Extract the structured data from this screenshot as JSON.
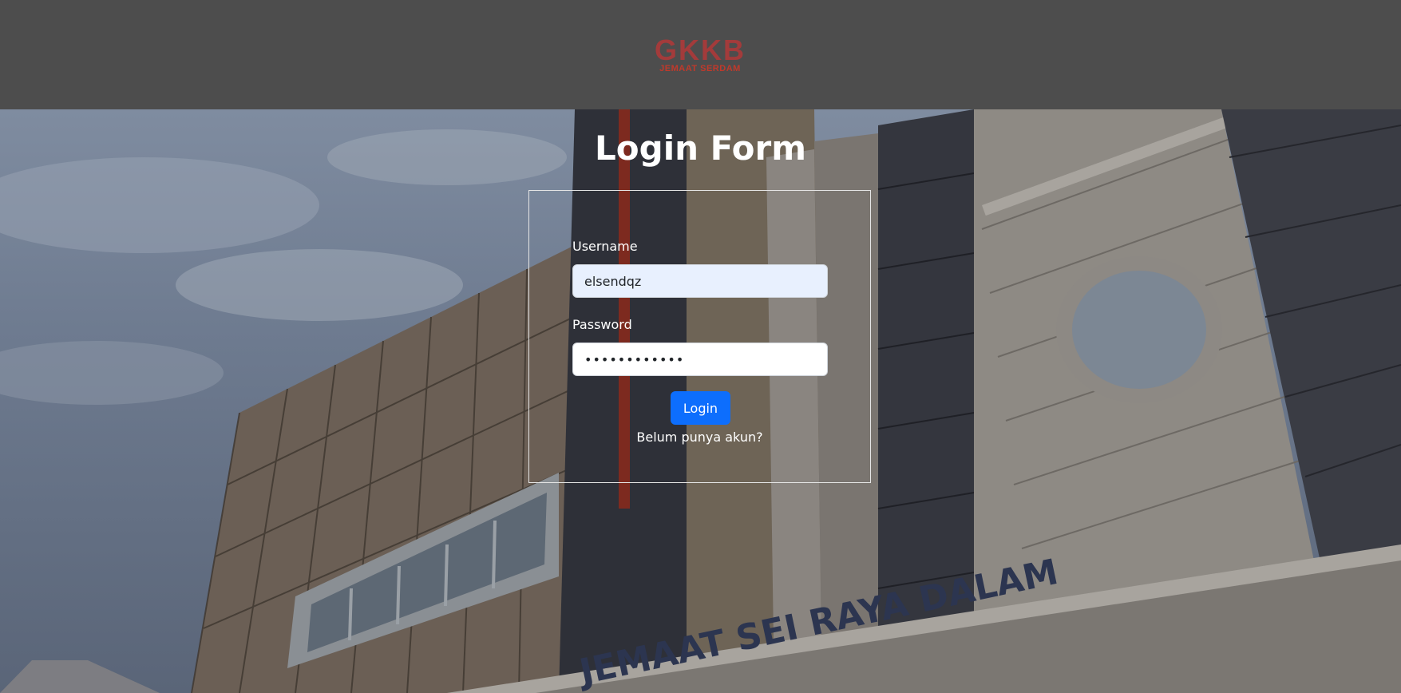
{
  "header": {
    "logo_main": "GKKB",
    "logo_sub": "JEMAAT SERDAM"
  },
  "hero": {
    "background_sign": "JEMAAT SEI RAYA DALAM"
  },
  "login_form": {
    "title": "Login Form",
    "username_label": "Username",
    "username_value": "elsendqz",
    "password_label": "Password",
    "password_value": "elsendqz1234",
    "login_label": "Login",
    "register_link": "Belum punya akun?"
  },
  "colors": {
    "header_bg": "#4d4d4d",
    "logo_red": "#a33b3b",
    "button_blue": "#0d6efd",
    "autofill_field_bg": "#e8f0fe"
  }
}
